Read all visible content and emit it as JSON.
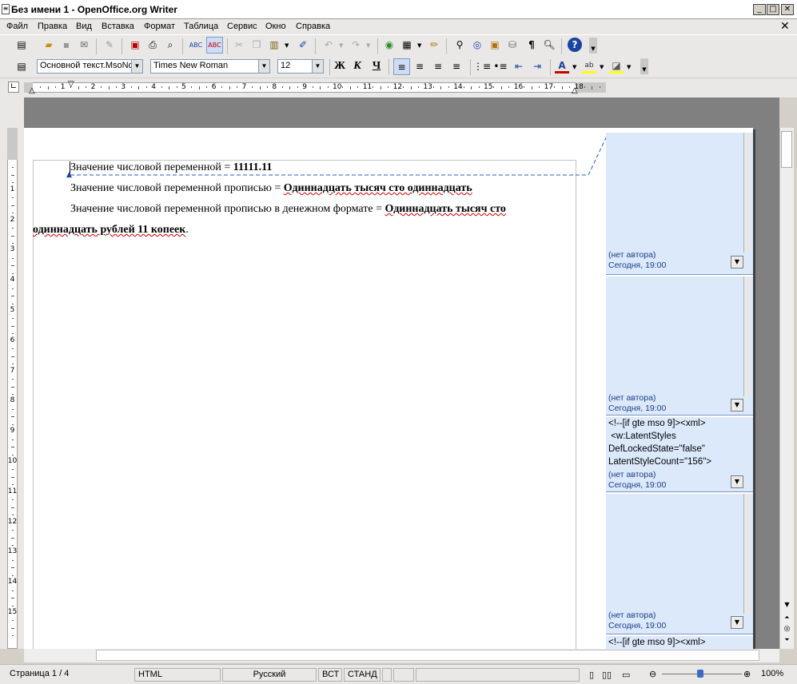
{
  "window": {
    "title": "Без имени 1 - OpenOffice.org Writer"
  },
  "menu": [
    "Файл",
    "Правка",
    "Вид",
    "Вставка",
    "Формат",
    "Таблица",
    "Сервис",
    "Окно",
    "Справка"
  ],
  "toolbar2": {
    "style_value": "Основной текст.MsoNo",
    "font_value": "Times New Roman",
    "size_value": "12",
    "bold_label": "Ж",
    "italic_label": "К",
    "underline_label": "Ч"
  },
  "ruler": {
    "h_numbers": [
      "1",
      "2",
      "3",
      "4",
      "5",
      "6",
      "7",
      "8",
      "9",
      "10",
      "11",
      "12",
      "13",
      "14",
      "15",
      "16",
      "17",
      "18"
    ],
    "v_numbers": [
      "1",
      "2",
      "3",
      "4",
      "5",
      "6",
      "7",
      "8",
      "9",
      "10",
      "11",
      "12",
      "13",
      "14",
      "15"
    ]
  },
  "document": {
    "line1_plain": "Значение числовой переменной = ",
    "line1_value": "11111.11",
    "line2_plain": "Значение числовой переменной прописью = ",
    "line2_value": "Одиннадцать тысяч сто одиннадцать",
    "line3_plain": "Значение числовой переменной прописью в денежном формате = ",
    "line3_value_a": "Одиннадцать тысяч сто",
    "line3_value_b": "одиннадцать рублей 11 копеек",
    "line3_end": "."
  },
  "comments": [
    {
      "text": "",
      "author": "(нет автора)",
      "date": "Сегодня, 19:00"
    },
    {
      "text": "",
      "author": "(нет автора)",
      "date": "Сегодня, 19:00"
    },
    {
      "text": "<!--[if gte mso 9]><xml>\n <w:LatentStyles\nDefLockedState=\"false\"\nLatentStyleCount=\"156\">",
      "author": "(нет автора)",
      "date": "Сегодня, 19:00"
    },
    {
      "text": "",
      "author": "(нет автора)",
      "date": "Сегодня, 19:00"
    },
    {
      "text": "<!--[if gte mso 9]><xml>",
      "author": "",
      "date": ""
    }
  ],
  "status": {
    "page": "Страница  1 / 4",
    "mode": "HTML",
    "lang": "Русский",
    "insert": "ВСТ",
    "select": "СТАНД",
    "zoom": "100%"
  }
}
